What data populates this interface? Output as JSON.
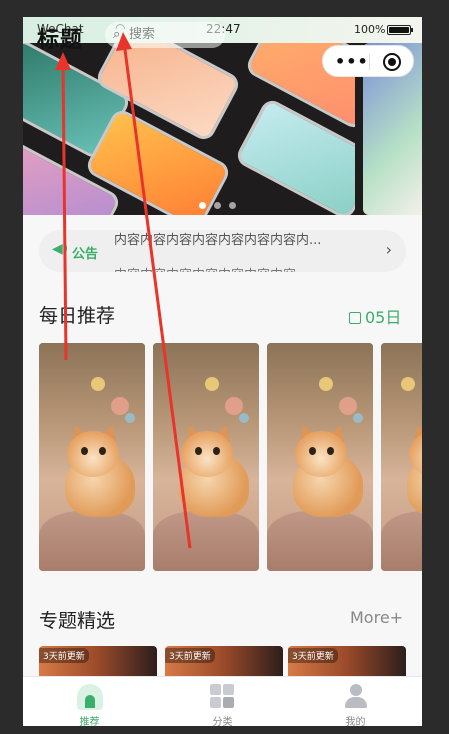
{
  "status_bar": {
    "carrier": "WeChat",
    "wifi_icon": "wifi-icon",
    "time": "22:47",
    "battery_text": "100%",
    "battery_level": 1.0
  },
  "nav": {
    "title": "标题",
    "search_placeholder": "搜索",
    "more_icon": "more-dots-icon",
    "close_icon": "target-icon"
  },
  "banner": {
    "indicator_count": 3,
    "active_index": 0
  },
  "notice": {
    "label": "公告",
    "text": "内容内容内容内容内容内容内容内...",
    "text_next": "内容内容内容内容内容内容内容",
    "arrow_icon": "chevron-right-icon"
  },
  "daily": {
    "title": "每日推荐",
    "date": "05日",
    "date_icon": "calendar-icon"
  },
  "topics": {
    "title": "专题精选",
    "more": "More+",
    "items": [
      {
        "badge": "3天前更新"
      },
      {
        "badge": "3天前更新"
      },
      {
        "badge": "3天前更新"
      }
    ]
  },
  "tabbar": {
    "tabs": [
      {
        "label": "推荐",
        "icon": "home-icon",
        "active": true
      },
      {
        "label": "分类",
        "icon": "grid-icon",
        "active": false
      },
      {
        "label": "我的",
        "icon": "user-icon",
        "active": false
      }
    ]
  },
  "colors": {
    "accent": "#3aae6a",
    "inactive": "#888888",
    "annotation": "#e8342a"
  }
}
